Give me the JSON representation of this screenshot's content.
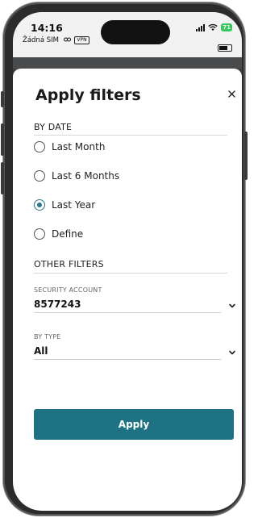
{
  "status_bar": {
    "time": "14:16",
    "carrier": "Žádná SIM",
    "vpn_label": "VPN",
    "battery": "71"
  },
  "sheet": {
    "title": "Apply filters",
    "by_date": {
      "heading": "BY DATE",
      "options": [
        {
          "label": "Last Month",
          "selected": false
        },
        {
          "label": "Last 6 Months",
          "selected": false
        },
        {
          "label": "Last Year",
          "selected": true
        },
        {
          "label": "Define",
          "selected": false
        }
      ]
    },
    "other_filters": {
      "heading": "OTHER FILTERS",
      "security_account": {
        "label": "SECURITY ACCOUNT",
        "value": "8577243"
      },
      "by_type": {
        "label": "BY TYPE",
        "value": "All"
      }
    },
    "apply_label": "Apply"
  },
  "colors": {
    "accent": "#1f7283",
    "radio_selected": "#2a7a8c",
    "battery": "#35c759"
  },
  "icons": {
    "close": "close-icon",
    "dropdown": "chevron-down-icon"
  }
}
